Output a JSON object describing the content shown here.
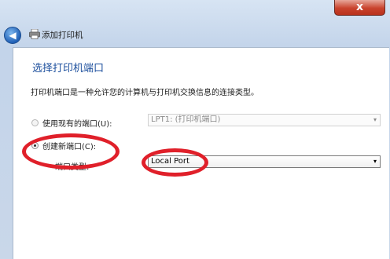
{
  "window": {
    "title": "添加打印机",
    "close_label": "x"
  },
  "page": {
    "heading": "选择打印机端口",
    "description": "打印机端口是一种允许您的计算机与打印机交换信息的连接类型。"
  },
  "options": {
    "existing_port": {
      "label": "使用现有的端口(U):",
      "selected_value": "LPT1: (打印机端口)",
      "checked": false
    },
    "new_port": {
      "label": "创建新端口(C):",
      "checked": true
    },
    "port_type": {
      "label": "端口类型:",
      "selected_value": "Local Port"
    }
  },
  "icons": {
    "back": "back-arrow-icon",
    "printer": "printer-icon",
    "dropdown": "chevron-down-icon"
  },
  "colors": {
    "highlight": "#e0202a",
    "heading": "#1b4e9c"
  }
}
